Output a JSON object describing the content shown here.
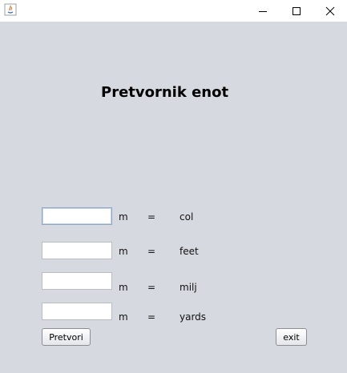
{
  "window": {
    "minimize_icon": "minimize-icon",
    "maximize_icon": "maximize-icon",
    "close_icon": "close-icon",
    "app_icon": "java-app-icon"
  },
  "main": {
    "title": "Pretvornik enot"
  },
  "rows": [
    {
      "value": "",
      "unit": "m",
      "equals": "=",
      "target": "col"
    },
    {
      "value": "",
      "unit": "m",
      "equals": "=",
      "target": "feet"
    },
    {
      "value": "",
      "unit": "m",
      "equals": "=",
      "target": "milj"
    },
    {
      "value": "",
      "unit": "m",
      "equals": "=",
      "target": "yards"
    }
  ],
  "buttons": {
    "convert": "Pretvori",
    "exit": "exit"
  }
}
